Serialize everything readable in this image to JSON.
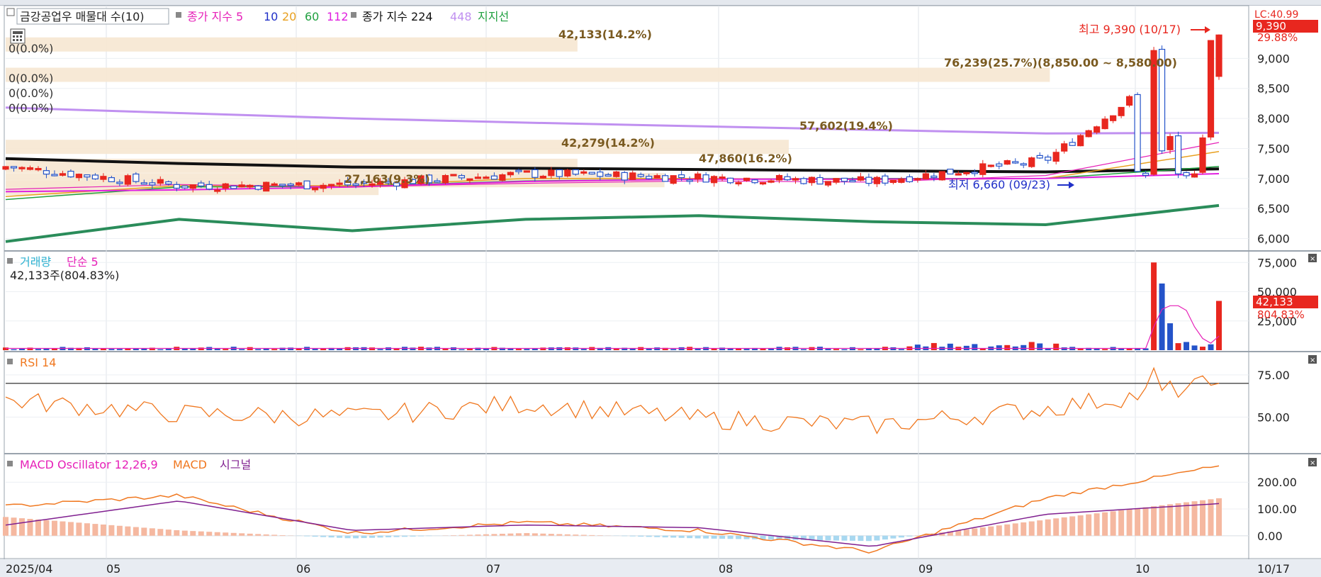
{
  "price_panel": {
    "legend": {
      "title": "금강공업우 매물대 수(10)",
      "ma_label": "종가 지수 5",
      "ma_periods": [
        "10",
        "20",
        "60",
        "112"
      ],
      "ma224_label": "종가 지수 224",
      "ma448_label": "448",
      "support_label": "지지선"
    },
    "high_label": "최고 9,390 (10/17)",
    "low_label": "최저 6,660 (09/23)",
    "current_price_box": "9,390",
    "current_change_box": "29.88%",
    "lc_label": "LC:40.99",
    "left_zero_labels": [
      "0(0.0%)",
      "0(0.0%)",
      "0(0.0%)",
      "0(0.0%)"
    ],
    "volume_profile_labels": [
      "42,133(14.2%)",
      "76,239(25.7%)(8,850.00 ~ 8,580.00)",
      "57,602(19.4%)",
      "42,279(14.2%)",
      "27,163(9.3%)",
      "47,860(16.2%)"
    ],
    "axis_ticks": [
      "9,000",
      "8,500",
      "8,000",
      "7,500",
      "7,000",
      "6,500",
      "6,000"
    ]
  },
  "volume_panel": {
    "legend_title": "거래량",
    "legend_ma": "단순 5",
    "info": "42,133주(804.83%)",
    "last_value_box": "42,133",
    "last_pct_box": "804.83%",
    "axis_ticks": [
      "75,000",
      "50,000",
      "25,000"
    ]
  },
  "rsi_panel": {
    "legend": "RSI 14",
    "axis_ticks": [
      "75.00",
      "50.00"
    ]
  },
  "macd_panel": {
    "legend_osc": "MACD Oscillator 12,26,9",
    "legend_macd": "MACD",
    "legend_signal": "시그널",
    "axis_ticks": [
      "200.00",
      "100.00",
      "0.00"
    ]
  },
  "date_axis": {
    "labels": [
      "2025/04",
      "05",
      "06",
      "07",
      "08",
      "09",
      "10"
    ],
    "end_label": "10/17"
  },
  "colors": {
    "up": "#e8271f",
    "down": "#2453c9",
    "ma5": "#e620b8",
    "ma10": "#2030c8",
    "ma20": "#e8a020",
    "ma60": "#20a040",
    "ma112": "#e020e0",
    "ma224": "#111111",
    "ma448": "#c090f0",
    "support": "#2a8c5a",
    "vol_profile": "#f6e7d2",
    "rsi": "#f07820",
    "macd": "#f07820",
    "signal": "#802090",
    "osc_pos": "#f5b8a0",
    "osc_neg": "#a8d8f0"
  },
  "chart_data": [
    {
      "type": "candlestick",
      "x_range": [
        "2025-04",
        "2025-10-17"
      ],
      "ylim": [
        5900,
        9500
      ],
      "high": {
        "value": 9390,
        "date": "10/17"
      },
      "low": {
        "value": 6660,
        "date": "09/23"
      },
      "last": {
        "value": 9390,
        "change_pct": 29.88
      },
      "closes_by_month": [
        {
          "x": "2025/04",
          "close": 7200
        },
        {
          "x": "05",
          "close": 6880
        },
        {
          "x": "06",
          "close": 6900
        },
        {
          "x": "07",
          "close": 7080
        },
        {
          "x": "08",
          "close": 7020
        },
        {
          "x": "09",
          "close": 6950
        },
        {
          "x": "10",
          "close": 7300
        },
        {
          "x": "10/17",
          "close": 9390
        }
      ],
      "series": [
        {
          "name": "224",
          "approx_values": [
            7330,
            7250,
            7190,
            7170,
            7150,
            7130,
            7110,
            7160
          ]
        },
        {
          "name": "448",
          "approx_values": [
            8180,
            8090,
            8000,
            7930,
            7870,
            7810,
            7750,
            7760
          ]
        },
        {
          "name": "지지선",
          "approx_values": [
            5950,
            6320,
            6130,
            6320,
            6380,
            6280,
            6230,
            6550
          ]
        }
      ],
      "volume_profile": [
        {
          "label": "42,133(14.2%)",
          "volume": 42133,
          "pct": 14.2
        },
        {
          "label": "76,239(25.7%)(8,850.00 ~ 8,580.00)",
          "volume": 76239,
          "pct": 25.7,
          "range": [
            8580,
            8850
          ]
        },
        {
          "label": "57,602(19.4%)",
          "volume": 57602,
          "pct": 19.4
        },
        {
          "label": "42,279(14.2%)",
          "volume": 42279,
          "pct": 14.2
        },
        {
          "label": "27,163(9.3%)",
          "volume": 27163,
          "pct": 9.3
        },
        {
          "label": "47,860(16.2%)",
          "volume": 47860,
          "pct": 16.2
        }
      ]
    },
    {
      "type": "bar",
      "title": "거래량",
      "ylim": [
        0,
        80000
      ],
      "last": {
        "value": 42133,
        "pct": 804.83
      },
      "values_recent": [
        {
          "x": "09 late",
          "value": 75000
        },
        {
          "x": "10",
          "value": 57000
        },
        {
          "x": "10",
          "value": 23000
        },
        {
          "x": "10/17",
          "value": 42133
        }
      ]
    },
    {
      "type": "line",
      "title": "RSI 14",
      "ylim": [
        30,
        85
      ],
      "values_by_month": [
        {
          "x": "2025/04",
          "y": 60
        },
        {
          "x": "05",
          "y": 52
        },
        {
          "x": "06",
          "y": 50
        },
        {
          "x": "07",
          "y": 58
        },
        {
          "x": "08",
          "y": 49
        },
        {
          "x": "09",
          "y": 45
        },
        {
          "x": "10",
          "y": 55
        },
        {
          "x": "10/17",
          "y": 70
        }
      ]
    },
    {
      "type": "line",
      "title": "MACD Oscillator 12,26,9",
      "ylim": [
        -80,
        280
      ],
      "series": [
        {
          "name": "MACD",
          "approx_values": [
            110,
            150,
            10,
            50,
            20,
            -60,
            140,
            260
          ]
        },
        {
          "name": "시그널",
          "approx_values": [
            40,
            130,
            20,
            40,
            30,
            -40,
            80,
            120
          ]
        }
      ]
    }
  ]
}
